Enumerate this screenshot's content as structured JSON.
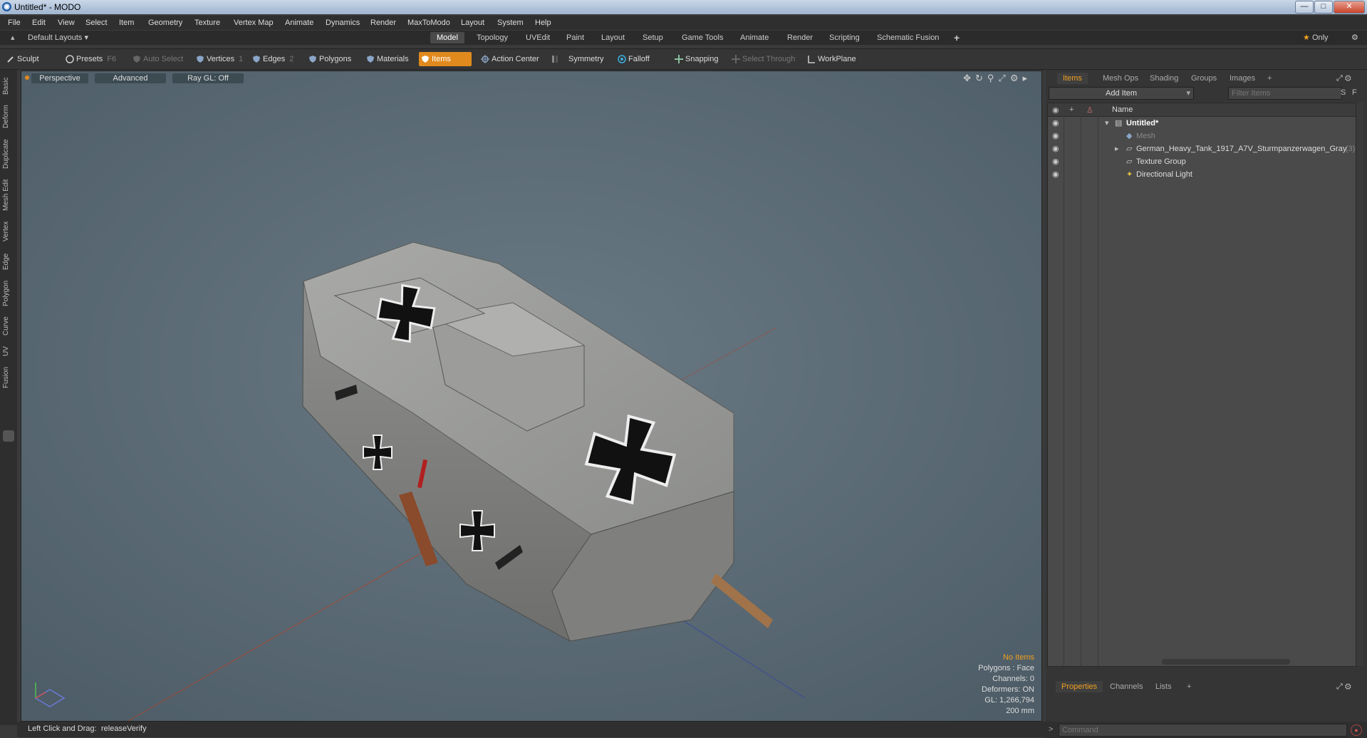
{
  "titlebar": {
    "title": "Untitled* - MODO",
    "min": "—",
    "max": "□",
    "close": "✕"
  },
  "menu": [
    "File",
    "Edit",
    "View",
    "Select",
    "Item",
    "Geometry",
    "Texture",
    "Vertex Map",
    "Animate",
    "Dynamics",
    "Render",
    "MaxToModo",
    "Layout",
    "System",
    "Help"
  ],
  "layout": {
    "selector": "Default Layouts",
    "tabs": [
      "Model",
      "Topology",
      "UVEdit",
      "Paint",
      "Layout",
      "Setup",
      "Game Tools",
      "Animate",
      "Render",
      "Scripting",
      "Schematic Fusion"
    ],
    "active_tab": "Model",
    "add": "+",
    "only": "Only"
  },
  "toolbar": {
    "sculpt": "Sculpt",
    "presets": "Presets",
    "presets_key": "F6",
    "auto_select": "Auto Select",
    "vertices": "Vertices",
    "vertices_key": "1",
    "edges": "Edges",
    "edges_key": "2",
    "polygons": "Polygons",
    "materials": "Materials",
    "items": "Items",
    "action_center": "Action Center",
    "symmetry": "Symmetry",
    "falloff": "Falloff",
    "snapping": "Snapping",
    "select_through": "Select Through",
    "workplane": "WorkPlane"
  },
  "left_tabs": [
    "Basic",
    "Deform",
    "Duplicate",
    "Mesh Edit",
    "Vertex",
    "Edge",
    "Polygon",
    "Curve",
    "UV",
    "Fusion"
  ],
  "viewport": {
    "view": "Perspective",
    "shading": "Advanced",
    "raygl": "Ray GL: Off",
    "info": {
      "no_items": "No Items",
      "polygons": "Polygons : Face",
      "channels": "Channels: 0",
      "deformers": "Deformers: ON",
      "gl": "GL: 1,266,794",
      "scale": "200 mm"
    }
  },
  "right_panel": {
    "tabs": [
      "Items",
      "Mesh Ops",
      "Shading",
      "Groups",
      "Images"
    ],
    "active_tab": "Items",
    "add_item": "Add Item",
    "filter_placeholder": "Filter Items",
    "col_name": "Name",
    "items": [
      {
        "label": "Untitled*",
        "level": 0
      },
      {
        "label": "Mesh",
        "level": 1
      },
      {
        "label": "German_Heavy_Tank_1917_A7V_Sturmpanzerwagen_Gray",
        "level": 1,
        "count": "(3)"
      },
      {
        "label": "Texture Group",
        "level": 1
      },
      {
        "label": "Directional Light",
        "level": 1
      }
    ],
    "bottom_tabs": [
      "Properties",
      "Channels",
      "Lists"
    ],
    "bottom_active": "Properties"
  },
  "status": {
    "hint": "Left Click and Drag:",
    "action": "releaseVerify"
  },
  "command": {
    "prompt": ">",
    "placeholder": "Command"
  },
  "colors": {
    "accent": "#e08a1e",
    "viewport_bg": "#5a6a75",
    "panel": "#4a4a4a"
  }
}
